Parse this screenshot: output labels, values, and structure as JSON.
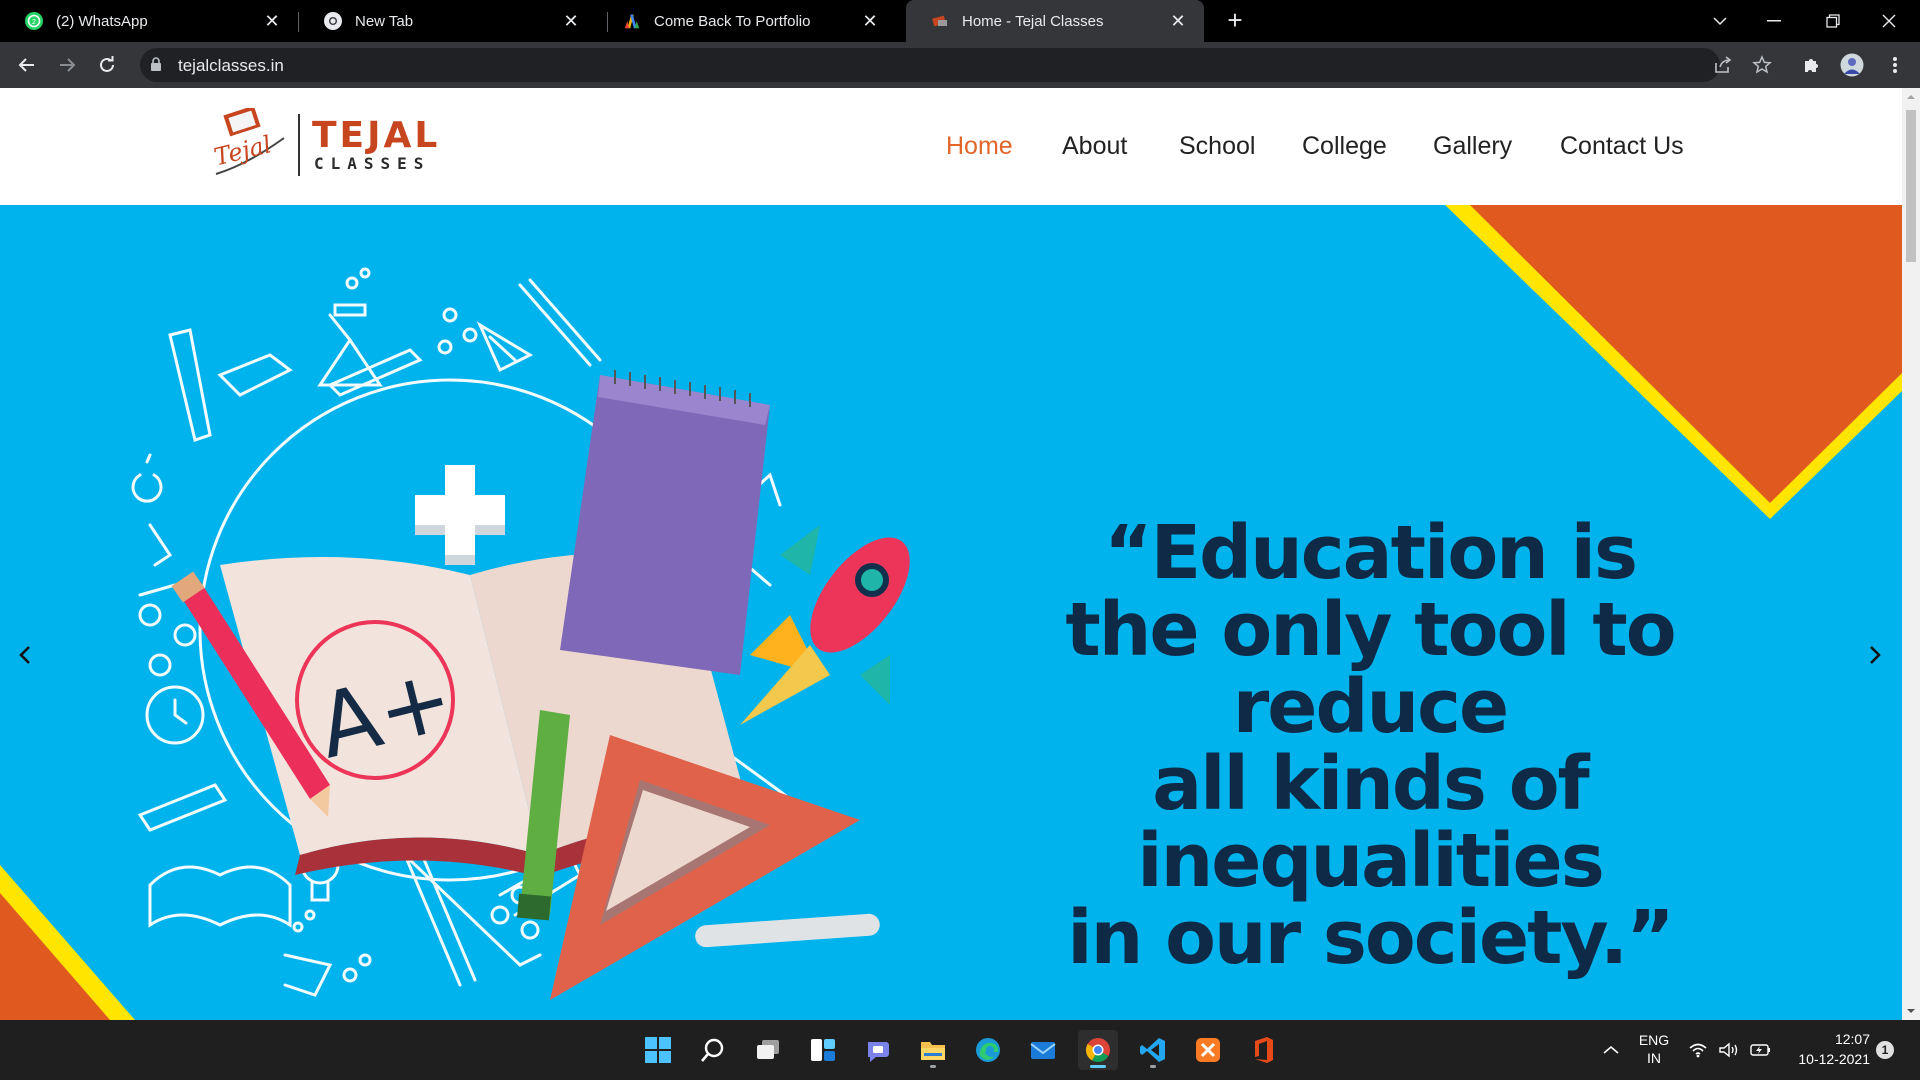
{
  "browser": {
    "tabs": [
      {
        "title": "(2) WhatsApp",
        "icon": "whatsapp-icon",
        "active": false
      },
      {
        "title": "New Tab",
        "icon": "chrome-icon",
        "active": false
      },
      {
        "title": "Come Back To Portfolio",
        "icon": "portfolio-icon",
        "active": false
      },
      {
        "title": "Home - Tejal Classes",
        "icon": "tejal-favicon-icon",
        "active": true
      }
    ],
    "url": "tejalclasses.in"
  },
  "site": {
    "logo": {
      "brand": "TEJAL",
      "sub": "CLASSES",
      "script": "Tejal"
    },
    "nav": [
      {
        "label": "Home",
        "active": true
      },
      {
        "label": "About",
        "active": false
      },
      {
        "label": "School",
        "active": false
      },
      {
        "label": "College",
        "active": false
      },
      {
        "label": "Gallery",
        "active": false
      },
      {
        "label": "Contact Us",
        "active": false
      }
    ],
    "hero": {
      "quote_lines": [
        "“Education is",
        "the only tool to reduce",
        "all kinds of inequalities",
        "in our society.”"
      ],
      "colors": {
        "background": "#00b3ec",
        "accent_orange": "#e05a1f",
        "accent_yellow": "#ffe500",
        "quote": "#0e2a47"
      }
    },
    "colors": {
      "nav_active": "#e2662a",
      "brand": "#c8461f"
    }
  },
  "taskbar": {
    "apps": [
      "windows-start-icon",
      "search-icon",
      "task-view-icon",
      "widgets-icon",
      "teams-chat-icon",
      "file-explorer-icon",
      "edge-icon",
      "mail-icon",
      "chrome-icon",
      "vscode-icon",
      "xampp-icon",
      "office-icon"
    ],
    "lang": {
      "line1": "ENG",
      "line2": "IN"
    },
    "time": "12:07",
    "date": "10-12-2021",
    "notification_count": "1"
  }
}
